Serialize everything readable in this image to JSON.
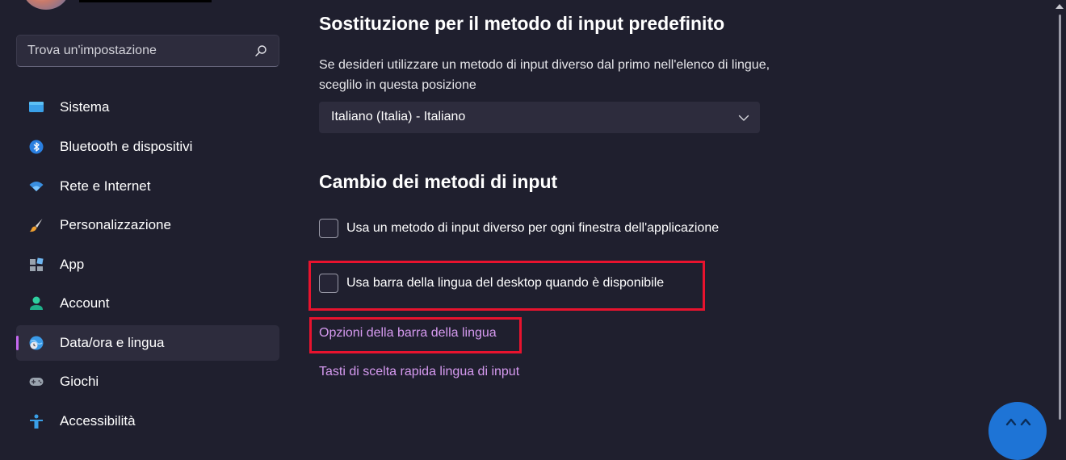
{
  "sidebar": {
    "search": {
      "placeholder": "Trova un'impostazione"
    },
    "items": [
      {
        "label": "Sistema"
      },
      {
        "label": "Bluetooth e dispositivi"
      },
      {
        "label": "Rete e Internet"
      },
      {
        "label": "Personalizzazione"
      },
      {
        "label": "App"
      },
      {
        "label": "Account"
      },
      {
        "label": "Data/ora e lingua"
      },
      {
        "label": "Giochi"
      },
      {
        "label": "Accessibilità"
      }
    ]
  },
  "main": {
    "override_section": {
      "title": "Sostituzione per il metodo di input predefinito",
      "description": "Se desideri utilizzare un metodo di input diverso dal primo nell'elenco di lingue, sceglilo in questa posizione",
      "dropdown_value": "Italiano (Italia) - Italiano"
    },
    "switching_section": {
      "title": "Cambio dei metodi di input",
      "checkbox1_label": "Usa un metodo di input diverso per ogni finestra dell'applicazione",
      "checkbox2_label": "Usa barra della lingua del desktop quando è disponibile",
      "link1": "Opzioni della barra della lingua",
      "link2": "Tasti di scelta rapida lingua di input"
    }
  },
  "colors": {
    "background": "#1f1f2e",
    "accent": "#c568f0",
    "link": "#d69af0",
    "highlight": "#e8132e"
  },
  "icons": [
    "search-icon",
    "sistema-icon",
    "bluetooth-icon",
    "wifi-icon",
    "brush-icon",
    "apps-icon",
    "account-icon",
    "globe-clock-icon",
    "gamepad-icon",
    "accessibility-icon",
    "chevron-down-icon"
  ]
}
